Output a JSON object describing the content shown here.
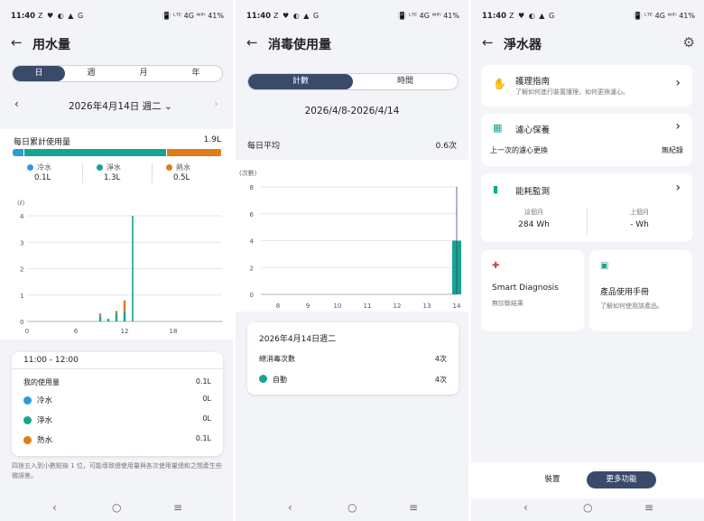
{
  "colors": {
    "cold": "#2e9bd6",
    "pure": "#17a391",
    "hot": "#e07d19",
    "nav": "#3a4a6b"
  },
  "status": {
    "time": "11:40",
    "left_icons": "Z ♥ ◐ ▲ G",
    "right_text": "📳 ᴸᵀᴱ 4G ᵂⁱᶠⁱ 41%"
  },
  "p1": {
    "title": "用水量",
    "tabs": [
      "日",
      "週",
      "月",
      "年"
    ],
    "date": "2026年4月14日 週二",
    "daily_label": "每日累計使用量",
    "daily_value": "1.9L",
    "legend": [
      {
        "name": "冷水",
        "value": "0.1L",
        "color": "#2e9bd6"
      },
      {
        "name": "淨水",
        "value": "1.3L",
        "color": "#17a391"
      },
      {
        "name": "熱水",
        "value": "0.5L",
        "color": "#e07d19"
      }
    ],
    "chart_data": {
      "type": "bar",
      "ylabel": "(ℓ)",
      "ylim": [
        0,
        4
      ],
      "yticks": [
        "0",
        "1",
        "2",
        "3",
        "4"
      ],
      "xticks": [
        "0",
        "6",
        "12",
        "18"
      ],
      "x": [
        9,
        10,
        11,
        12,
        13
      ],
      "series": [
        {
          "name": "冷水",
          "values": [
            0,
            0,
            0,
            0,
            0
          ]
        },
        {
          "name": "淨水",
          "values": [
            0.2,
            0.1,
            0.3,
            0.4,
            4.0
          ]
        },
        {
          "name": "熱水",
          "values": [
            0.1,
            0,
            0.1,
            0.4,
            0
          ]
        }
      ]
    },
    "tooltip": {
      "range": "11:00 - 12:00",
      "total_label": "我的使用量",
      "total_value": "0.1L",
      "items": [
        {
          "name": "冷水",
          "value": "0L",
          "color": "#2e9bd6"
        },
        {
          "name": "淨水",
          "value": "0L",
          "color": "#17a391"
        },
        {
          "name": "熱水",
          "value": "0.1L",
          "color": "#e07d19"
        }
      ]
    },
    "footnote": "四捨五入到小數點後 1 位，可能導致總使用量與各次使用量總和之間產生些微誤差。"
  },
  "p2": {
    "title": "消毒使用量",
    "tabs": [
      "計數",
      "時間"
    ],
    "range": "2026/4/8-2026/4/14",
    "avg_label": "每日平均",
    "avg_value": "0.6次",
    "chart_data": {
      "type": "bar",
      "ylabel": "(次數)",
      "ylim": [
        0,
        8
      ],
      "yticks": [
        "0",
        "2",
        "4",
        "6",
        "8"
      ],
      "categories": [
        "8",
        "9",
        "10",
        "11",
        "12",
        "13",
        "14"
      ],
      "values": [
        0,
        0,
        0,
        0,
        0,
        0,
        4
      ]
    },
    "tooltip": {
      "date": "2026年4月14日週二",
      "total_label": "總消毒次數",
      "total_value": "4次",
      "item_name": "自動",
      "item_value": "4次",
      "item_color": "#17a391"
    }
  },
  "p3": {
    "title": "淨水器",
    "guide_title": "護理指南",
    "guide_sub": "了解如何進行裝置護理，如何更換濾心。",
    "filter_title": "濾心保養",
    "filter_label": "上一次的濾心更換",
    "filter_value": "無紀錄",
    "energy_title": "能耗監測",
    "this_month_label": "這個月",
    "this_month_value": "284 Wh",
    "last_month_label": "上個月",
    "last_month_value": "- Wh",
    "diag_title": "Smart Diagnosis",
    "diag_sub": "無診斷結果",
    "manual_title": "產品使用手冊",
    "manual_sub": "了解如何使用該產品。",
    "bottom_tabs": [
      "裝置",
      "更多功能"
    ]
  }
}
